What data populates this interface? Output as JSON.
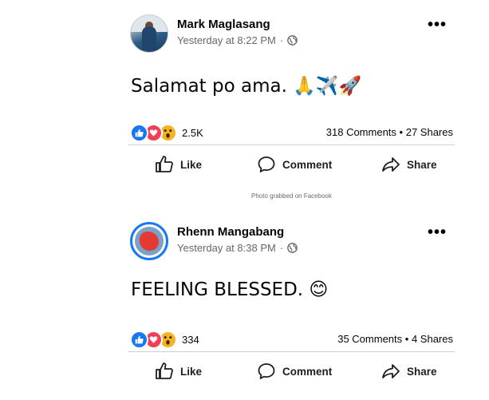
{
  "posts": [
    {
      "author": "Mark Maglasang",
      "timestamp": "Yesterday at 8:22 PM",
      "separator": "·",
      "text": "Salamat po ama. 🙏✈️🚀",
      "reaction_count": "2.5K",
      "comments": "318 Comments",
      "shares": "27 Shares",
      "dot": "•",
      "more": "•••",
      "actions": {
        "like": "Like",
        "comment": "Comment",
        "share": "Share"
      }
    },
    {
      "author": "Rhenn Mangabang",
      "timestamp": "Yesterday at 8:38 PM",
      "separator": "·",
      "text": "FEELING BLESSED. 😊",
      "reaction_count": "334",
      "comments": "35 Comments",
      "shares": "4 Shares",
      "dot": "•",
      "more": "•••",
      "actions": {
        "like": "Like",
        "comment": "Comment",
        "share": "Share"
      }
    }
  ],
  "caption": "Photo grabbed on Facebook",
  "colors": {
    "like_blue": "#1877f2",
    "love_red": "#f33e58",
    "wow_yellow": "#f7b125",
    "meta_gray": "#65676b"
  },
  "icons": [
    "globe-icon",
    "more-icon",
    "like-icon",
    "comment-icon",
    "share-icon",
    "like-reaction-icon",
    "love-reaction-icon",
    "wow-reaction-icon"
  ]
}
